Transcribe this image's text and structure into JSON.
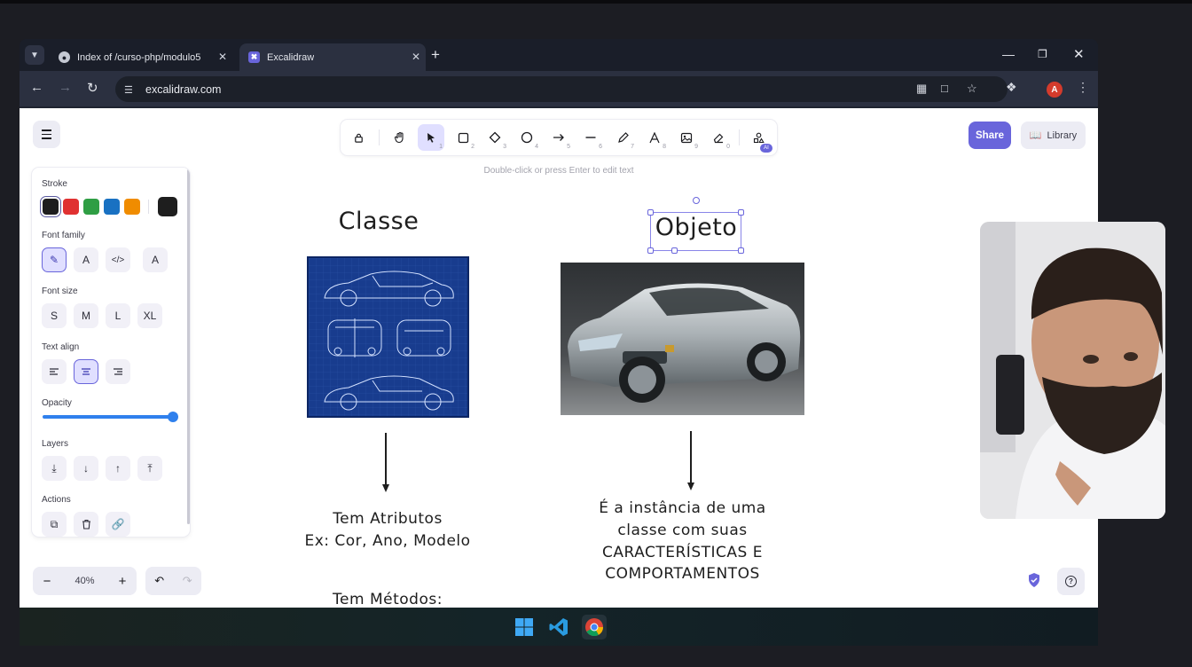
{
  "browser": {
    "tabs": [
      {
        "title": "Index of /curso-php/modulo5",
        "favicon": "globe-icon",
        "active": false
      },
      {
        "title": "Excalidraw",
        "favicon": "excalidraw-icon",
        "active": true
      }
    ],
    "url": "excalidraw.com",
    "profile_initial": "A"
  },
  "app": {
    "toolbar": {
      "tools": [
        {
          "name": "lock",
          "icon": "lock-icon",
          "key": ""
        },
        {
          "name": "hand",
          "icon": "hand-icon",
          "key": ""
        },
        {
          "name": "selection",
          "icon": "pointer-icon",
          "key": "1",
          "selected": true
        },
        {
          "name": "rectangle",
          "icon": "rectangle-icon",
          "key": "2"
        },
        {
          "name": "diamond",
          "icon": "diamond-icon",
          "key": "3"
        },
        {
          "name": "ellipse",
          "icon": "ellipse-icon",
          "key": "4"
        },
        {
          "name": "arrow",
          "icon": "arrow-icon",
          "key": "5"
        },
        {
          "name": "line",
          "icon": "line-icon",
          "key": "6"
        },
        {
          "name": "draw",
          "icon": "pencil-icon",
          "key": "7"
        },
        {
          "name": "text",
          "icon": "text-icon",
          "key": "8"
        },
        {
          "name": "image",
          "icon": "image-icon",
          "key": "9"
        },
        {
          "name": "eraser",
          "icon": "eraser-icon",
          "key": "0"
        },
        {
          "name": "more-tools",
          "icon": "shapes-icon",
          "key": "",
          "badge": "AI"
        }
      ],
      "hint": "Double-click or press Enter to edit text"
    },
    "share_label": "Share",
    "library_label": "Library",
    "properties": {
      "stroke_label": "Stroke",
      "stroke_colors": [
        "#1e1e1e",
        "#e03131",
        "#2f9e44",
        "#1971c2",
        "#f08c00"
      ],
      "current_stroke": "#1e1e1e",
      "font_family_label": "Font family",
      "font_size_label": "Font size",
      "font_sizes": [
        "S",
        "M",
        "L",
        "XL"
      ],
      "text_align_label": "Text align",
      "opacity_label": "Opacity",
      "opacity_value": 100,
      "layers_label": "Layers",
      "actions_label": "Actions"
    },
    "zoom": "40%"
  },
  "drawing": {
    "class_title": "Classe",
    "object_title": "Objeto",
    "class_text_1": "Tem Atributos",
    "class_text_2": "Ex: Cor, Ano, Modelo",
    "class_text_3": "Tem Métodos:",
    "object_text_1": "É a instância de uma",
    "object_text_2": "classe com suas",
    "object_text_3": "CARACTERÍSTICAS E",
    "object_text_4": "COMPORTAMENTOS"
  },
  "colors": {
    "accent": "#6965db",
    "accent_light": "#e0dfff"
  }
}
